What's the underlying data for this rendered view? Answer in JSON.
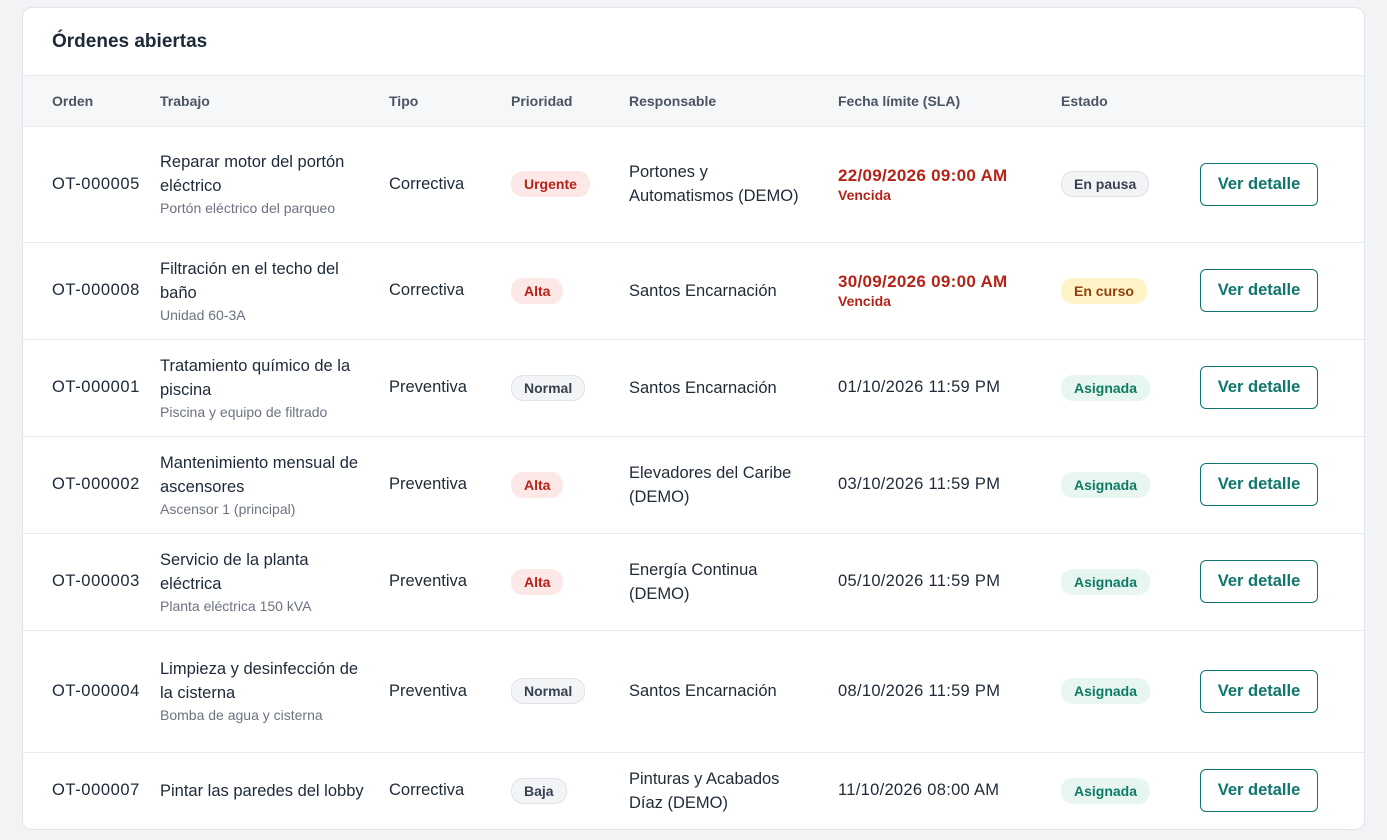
{
  "card": {
    "title": "Órdenes abiertas"
  },
  "columns": [
    "Orden",
    "Trabajo",
    "Tipo",
    "Prioridad",
    "Responsable",
    "Fecha límite (SLA)",
    "Estado"
  ],
  "action_label": "Ver detalle",
  "overdue_label": "Vencida",
  "priority_colors": {
    "urgent_alta": "#b42318",
    "normal_baja": "#374151"
  },
  "status_colors": {
    "asignada": "#0f7a63",
    "en_curso": "#92400e",
    "en_pausa": "#374151"
  },
  "accent_color": "#0f766e",
  "rows": [
    {
      "id": "OT-000005",
      "title": "Reparar motor del portón eléctrico",
      "subtitle": "Portón eléctrico del parqueo",
      "tipo": "Correctiva",
      "prioridad": "Urgente",
      "responsable": "Portones y Automatismos (DEMO)",
      "fecha": "22/09/2026 09:00 AM",
      "vencida": true,
      "estado": "En pausa"
    },
    {
      "id": "OT-000008",
      "title": "Filtración en el techo del baño",
      "subtitle": "Unidad 60-3A",
      "tipo": "Correctiva",
      "prioridad": "Alta",
      "responsable": "Santos Encarnación",
      "fecha": "30/09/2026 09:00 AM",
      "vencida": true,
      "estado": "En curso"
    },
    {
      "id": "OT-000001",
      "title": "Tratamiento químico de la piscina",
      "subtitle": "Piscina y equipo de filtrado",
      "tipo": "Preventiva",
      "prioridad": "Normal",
      "responsable": "Santos Encarnación",
      "fecha": "01/10/2026 11:59 PM",
      "vencida": false,
      "estado": "Asignada"
    },
    {
      "id": "OT-000002",
      "title": "Mantenimiento mensual de ascensores",
      "subtitle": "Ascensor 1 (principal)",
      "tipo": "Preventiva",
      "prioridad": "Alta",
      "responsable": "Elevadores del Caribe (DEMO)",
      "fecha": "03/10/2026 11:59 PM",
      "vencida": false,
      "estado": "Asignada"
    },
    {
      "id": "OT-000003",
      "title": "Servicio de la planta eléctrica",
      "subtitle": "Planta eléctrica 150 kVA",
      "tipo": "Preventiva",
      "prioridad": "Alta",
      "responsable": "Energía Continua (DEMO)",
      "fecha": "05/10/2026 11:59 PM",
      "vencida": false,
      "estado": "Asignada"
    },
    {
      "id": "OT-000004",
      "title": "Limpieza y desinfección de la cisterna",
      "subtitle": "Bomba de agua y cisterna",
      "tipo": "Preventiva",
      "prioridad": "Normal",
      "responsable": "Santos Encarnación",
      "fecha": "08/10/2026 11:59 PM",
      "vencida": false,
      "estado": "Asignada"
    },
    {
      "id": "OT-000007",
      "title": "Pintar las paredes del lobby",
      "subtitle": "",
      "tipo": "Correctiva",
      "prioridad": "Baja",
      "responsable": "Pinturas y Acabados Díaz (DEMO)",
      "fecha": "11/10/2026 08:00 AM",
      "vencida": false,
      "estado": "Asignada"
    }
  ]
}
